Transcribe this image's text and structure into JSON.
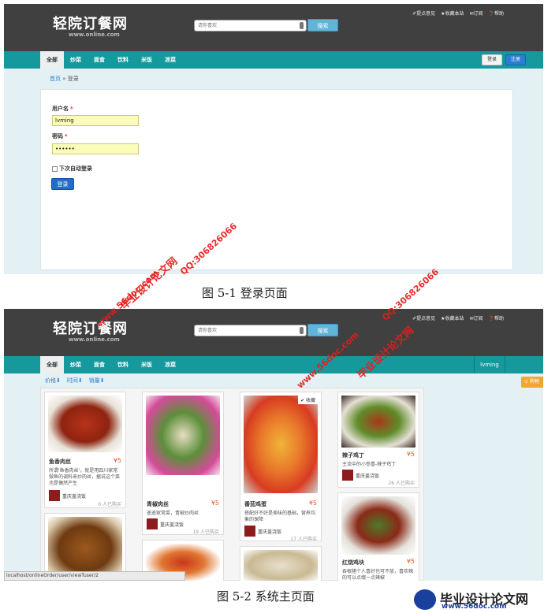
{
  "site": {
    "logo": "轻院订餐网",
    "domain": "www.online.com",
    "search_placeholder": "请你喜欢",
    "search_button": "搜索",
    "top_links": [
      "✐提点意见",
      "★收藏本站",
      "✉订阅",
      "❓帮助"
    ],
    "nav": [
      "全部",
      "炒菜",
      "面食",
      "饮料",
      "米饭",
      "凉菜"
    ]
  },
  "login_page": {
    "nav_login": "登录",
    "nav_register": "注册",
    "breadcrumb_home": "首页",
    "breadcrumb_sep": " » ",
    "breadcrumb_current": "登录",
    "username_label": "用户名",
    "required_mark": "*",
    "username_value": "lvming",
    "password_label": "密码",
    "password_value": "••••••",
    "remember_label": "下次自动登录",
    "submit": "登录"
  },
  "captions": {
    "fig1": "图 5-1    登录页面",
    "fig2": "图 5-2    系统主页面"
  },
  "main_page": {
    "user": "lvming",
    "sort": [
      "价格⬇",
      "时间⬇",
      "销量⬇"
    ],
    "shopping": "⊙ 购物",
    "favorite": "✔ 收藏",
    "status_url": "localhost/onlineOrder/user/viewTuser/2",
    "cards": [
      {
        "name": "鱼香肉丝",
        "price": "¥5",
        "desc": "所谓'鱼香肉丝'，就是用四川家常做鱼的调料来炒肉丝，据说这个菜也是偶然产生",
        "store": "重庆盖浇饭",
        "sold": "0 人已购买"
      },
      {
        "name": "青椒肉丝",
        "price": "¥5",
        "desc": "遥遥家常菜，青椒炒肉丝",
        "store": "重庆盖浇饭",
        "sold": "19 人已购买"
      },
      {
        "name": "番茄鸡蛋",
        "price": "¥5",
        "desc": "搭配好不好是美味的基础，营养均衡的保障",
        "store": "重庆盖浇饭",
        "sold": "17 人已购买"
      },
      {
        "name": "辣子鸡丁",
        "price": "¥5",
        "desc": "主流中的小惊喜-辣子鸡丁",
        "store": "重庆盖浇饭",
        "sold": "26 人已购买"
      },
      {
        "name": "红烧鸡块",
        "price": "¥5",
        "desc": "吞根猪个人喜好也可不放，喜欢辣的可以点缀一点辣椒",
        "store": "",
        "sold": ""
      }
    ]
  },
  "watermarks": {
    "cn": "毕业设计论文网",
    "url": "www.56doc.com",
    "qq": "QQ:306826066"
  },
  "brand": {
    "title": "毕业设计论文网",
    "url": "www.56doc.com"
  }
}
